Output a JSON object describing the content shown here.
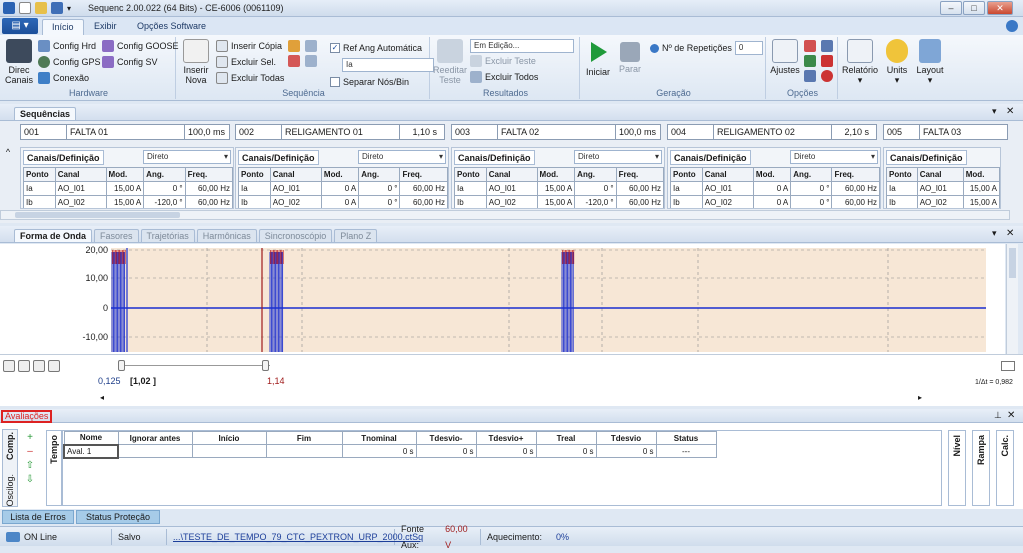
{
  "titlebar": {
    "title": "Sequenc 2.00.022 (64 Bits) - CE-6006 (0061109)",
    "min": "–",
    "max": "□",
    "close": "✕"
  },
  "ribbon_tabs": {
    "file": "▤ ▾",
    "tabs": [
      "Início",
      "Exibir",
      "Opções Software"
    ]
  },
  "hardware": {
    "direc": "Direc Canais",
    "config_hrd": "Config Hrd",
    "config_gps": "Config GPS",
    "conexao": "Conexão",
    "config_goose": "Config GOOSE",
    "config_sv": "Config SV",
    "label": "Hardware"
  },
  "sequencia": {
    "inserir_nova": "Inserir Nova",
    "inserir_copia": "Inserir Cópia",
    "excluir_sel": "Excluir Sel.",
    "excluir_todas": "Excluir Todas",
    "ref_ang": "Ref Ang Automática",
    "ref_value": "Ia",
    "separar": "Separar Nós/Bin",
    "label": "Sequência"
  },
  "resultados": {
    "reeditar": "Reeditar Teste",
    "status": "Em Edição...",
    "excluir_teste": "Excluir Teste",
    "excluir_todos": "Excluir Todos",
    "label": "Resultados"
  },
  "geracao": {
    "iniciar": "Iniciar",
    "parar": "Parar",
    "repeticoes": "Nº de Repetições",
    "rep_value": "0",
    "label": "Geração"
  },
  "opcoes": {
    "ajustes": "Ajustes",
    "label": "Opções"
  },
  "right_btns": {
    "relatorio": "Relatório",
    "units": "Units",
    "layout": "Layout"
  },
  "sequencias": {
    "title": "Sequências",
    "items": [
      {
        "num": "001",
        "name": "FALTA 01",
        "time": "100,0 ms"
      },
      {
        "num": "002",
        "name": "RELIGAMENTO 01",
        "time": "1,10 s"
      },
      {
        "num": "003",
        "name": "FALTA 02",
        "time": "100,0 ms"
      },
      {
        "num": "004",
        "name": "RELIGAMENTO 02",
        "time": "2,10 s"
      },
      {
        "num": "005",
        "name": "FALTA 03",
        "time": ""
      }
    ],
    "canais_tab": "Canais/Definição",
    "mode": "Direto",
    "headers": [
      "Ponto",
      "Canal",
      "Mod.",
      "Ang.",
      "Freq."
    ],
    "tables": [
      [
        [
          "Ia",
          "AO_I01",
          "15,00 A",
          "0 °",
          "60,00 Hz"
        ],
        [
          "Ib",
          "AO_I02",
          "15,00 A",
          "-120,0 °",
          "60,00 Hz"
        ]
      ],
      [
        [
          "Ia",
          "AO_I01",
          "0 A",
          "0 °",
          "60,00 Hz"
        ],
        [
          "Ib",
          "AO_I02",
          "0 A",
          "0 °",
          "60,00 Hz"
        ]
      ],
      [
        [
          "Ia",
          "AO_I01",
          "15,00 A",
          "0 °",
          "60,00 Hz"
        ],
        [
          "Ib",
          "AO_I02",
          "15,00 A",
          "-120,0 °",
          "60,00 Hz"
        ]
      ],
      [
        [
          "Ia",
          "AO_I01",
          "0 A",
          "0 °",
          "60,00 Hz"
        ],
        [
          "Ib",
          "AO_I02",
          "0 A",
          "0 °",
          "60,00 Hz"
        ]
      ],
      [
        [
          "Ia",
          "AO_I01",
          "15,00 A"
        ],
        [
          "Ib",
          "AO_I02",
          "15,00 A"
        ]
      ]
    ]
  },
  "view_tabs": [
    "Forma de Onda",
    "Fasores",
    "Trajetórias",
    "Harmônicas",
    "Sincronoscópio",
    "Plano Z"
  ],
  "waveform": {
    "y_ticks": [
      "20,00",
      "10,00",
      "0",
      "-10,00"
    ],
    "cursor1": "0,125",
    "cursor_mid": "[1,02 ]",
    "cursor2": "1,14",
    "delta": "1/Δt = 0,982"
  },
  "avaliacoes": {
    "title": "Avaliações",
    "side_tabs": [
      "Comp.",
      "Oscilog."
    ],
    "tempo": "Tempo",
    "headers": [
      "Nome",
      "Ignorar antes",
      "Início",
      "Fim",
      "Tnominal",
      "Tdesvio-",
      "Tdesvio+",
      "Treal",
      "Tdesvio",
      "Status"
    ],
    "row": [
      "Aval. 1",
      "",
      "",
      "",
      "0 s",
      "0 s",
      "0 s",
      "0 s",
      "0 s",
      "---"
    ],
    "right_tabs": [
      "Nível",
      "Rampa",
      "Calc."
    ]
  },
  "bottom_tabs": [
    "Lista de Erros",
    "Status Proteção"
  ],
  "status": {
    "online": "ON Line",
    "salvo": "Salvo",
    "file": "...\\TESTE_DE_TEMPO_79_CTC_PEXTRON_URP_2000.ctSq",
    "fonte_label": "Fonte Aux:",
    "fonte_value": "60,00 V",
    "aquec_label": "Aquecimento:",
    "aquec_value": "0%"
  }
}
